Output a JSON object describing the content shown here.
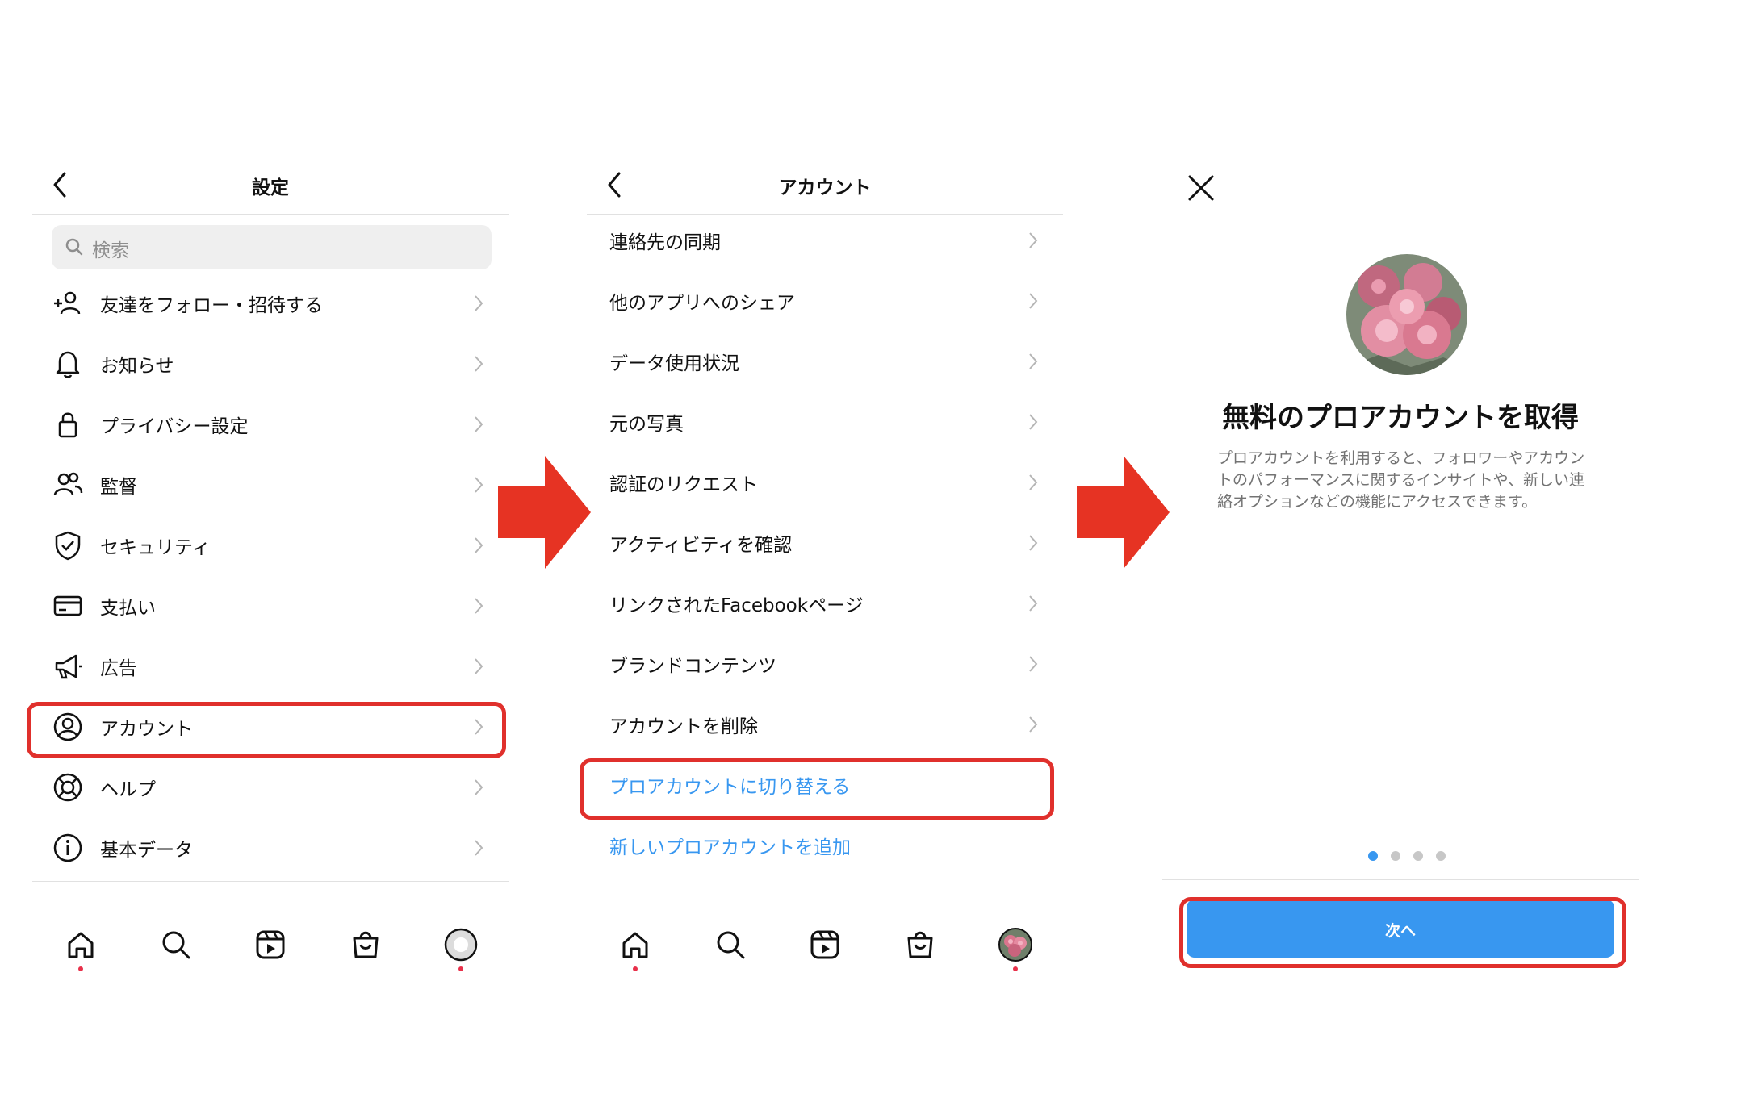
{
  "panel1": {
    "title": "設定",
    "search_placeholder": "検索",
    "items": [
      {
        "label": "友達をフォロー・招待する",
        "icon": "add-person-icon"
      },
      {
        "label": "お知らせ",
        "icon": "bell-icon"
      },
      {
        "label": "プライバシー設定",
        "icon": "lock-icon"
      },
      {
        "label": "監督",
        "icon": "people-icon"
      },
      {
        "label": "セキュリティ",
        "icon": "shield-check-icon"
      },
      {
        "label": "支払い",
        "icon": "credit-card-icon"
      },
      {
        "label": "広告",
        "icon": "megaphone-icon"
      },
      {
        "label": "アカウント",
        "icon": "account-circle-icon"
      },
      {
        "label": "ヘルプ",
        "icon": "lifebuoy-icon"
      },
      {
        "label": "基本データ",
        "icon": "info-icon"
      }
    ]
  },
  "panel2": {
    "title": "アカウント",
    "items": [
      {
        "label": "連絡先の同期"
      },
      {
        "label": "他のアプリへのシェア"
      },
      {
        "label": "データ使用状況"
      },
      {
        "label": "元の写真"
      },
      {
        "label": "認証のリクエスト"
      },
      {
        "label": "アクティビティを確認"
      },
      {
        "label": "リンクされたFacebookページ"
      },
      {
        "label": "ブランドコンテンツ"
      },
      {
        "label": "アカウントを削除"
      }
    ],
    "switch_pro": "プロアカウントに切り替える",
    "add_pro": "新しいプロアカウントを追加"
  },
  "panel3": {
    "title": "無料のプロアカウントを取得",
    "description": "プロアカウントを利用すると、フォロワーやアカウントのパフォーマンスに関するインサイトや、新しい連絡オプションなどの機能にアクセスできます。",
    "pager_active": 1,
    "pager_count": 4,
    "next_button": "次へ"
  },
  "colors": {
    "highlight": "#e0302c",
    "link_blue": "#3897f0",
    "arrow_red": "#e63323",
    "notification_dot": "#e8304a"
  }
}
